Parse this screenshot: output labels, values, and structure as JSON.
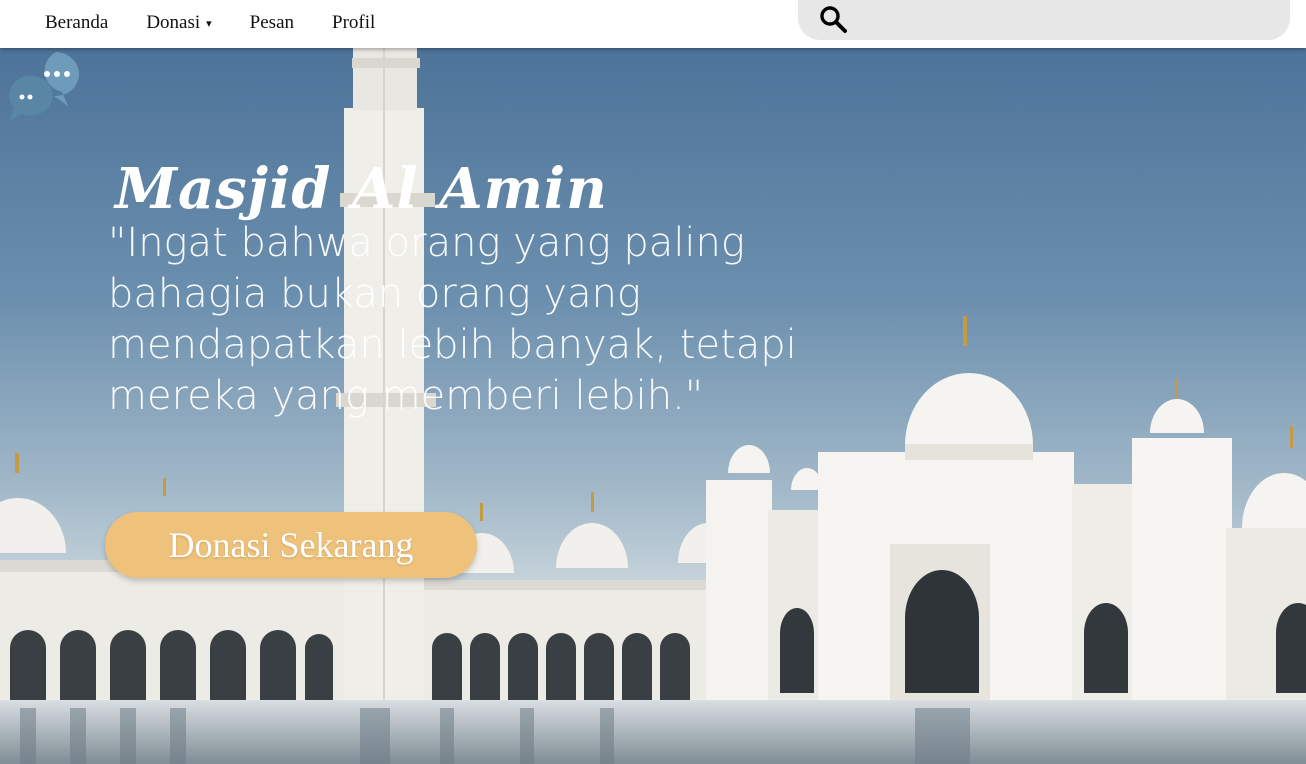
{
  "nav": {
    "items": [
      {
        "label": "Beranda"
      },
      {
        "label": "Donasi",
        "has_dropdown": true
      },
      {
        "label": "Pesan"
      },
      {
        "label": "Profil"
      }
    ],
    "dropdown_caret": "▾"
  },
  "search": {
    "icon": "search-icon",
    "value": "",
    "placeholder": ""
  },
  "hero": {
    "title": "Masjid Al Amin",
    "quote": "\"Ingat bahwa orang yang paling bahagia bukan orang yang mendapatkan lebih banyak, tetapi mereka yang memberi lebih.\"",
    "cta_label": "Donasi Sekarang"
  },
  "chat": {
    "icon": "chat-bubbles-icon"
  },
  "colors": {
    "cta": "#eec27a",
    "search_bg": "#e7e7e7",
    "chat_bubble": "#5b87a6",
    "text_light": "#ffffff"
  }
}
